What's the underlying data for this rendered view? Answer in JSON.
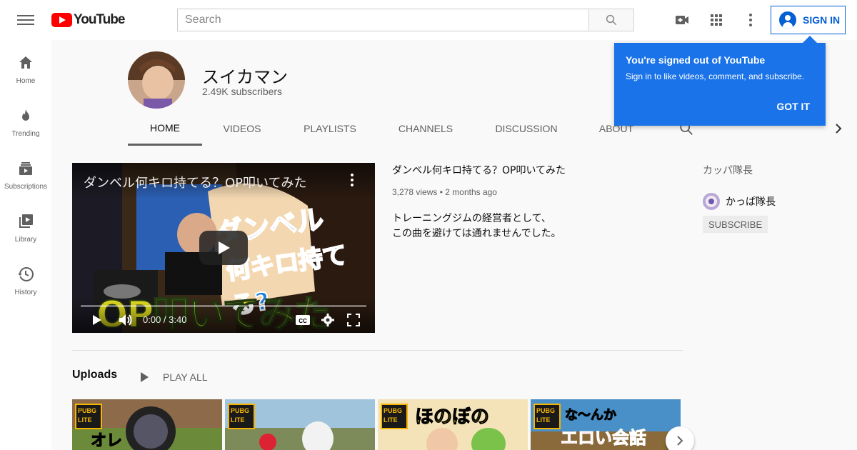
{
  "header": {
    "logo_text": "YouTube",
    "search_placeholder": "Search",
    "sign_in_label": "SIGN IN"
  },
  "sidebar": {
    "items": [
      {
        "label": "Home",
        "icon": "home-icon"
      },
      {
        "label": "Trending",
        "icon": "flame-icon"
      },
      {
        "label": "Subscriptions",
        "icon": "subscriptions-icon"
      },
      {
        "label": "Library",
        "icon": "library-icon"
      },
      {
        "label": "History",
        "icon": "history-icon"
      }
    ]
  },
  "channel": {
    "name": "スイカマン",
    "subscribers": "2.49K subscribers",
    "tabs": [
      "HOME",
      "VIDEOS",
      "PLAYLISTS",
      "CHANNELS",
      "DISCUSSION",
      "ABOUT"
    ],
    "active_tab": "HOME"
  },
  "featured_video": {
    "overlay_title": "ダンベル何キロ持てる？OP叩いてみた",
    "title": "ダンベル何キロ持てる？OP叩いてみた",
    "views": "3,278 views",
    "age": "2 months ago",
    "description_lines": [
      "トレーニングジムの経営者として、",
      "この曲を避けては通れませんでした。"
    ],
    "time": "0:00 / 3:40",
    "thumbnail_caption": "OP叩いてみた",
    "thumbnail_logo": "ダンベル",
    "thumbnail_logo_2": "何キロ持てる?"
  },
  "uploads": {
    "title": "Uploads",
    "play_all_label": "PLAY ALL",
    "thumbs": [
      {
        "badge": "PUBG LITE",
        "text": "オレ"
      },
      {
        "badge": "PUBG LITE",
        "text": ""
      },
      {
        "badge": "PUBG LITE",
        "text": "ほのぼの"
      },
      {
        "badge": "PUBG LITE",
        "text": "な〜んか",
        "text2": "エロい会話"
      }
    ]
  },
  "featured_channels": {
    "title": "カッパ隊長",
    "channel_name": "かっぱ隊長",
    "subscribe_label": "SUBSCRIBE"
  },
  "popup": {
    "title": "You're signed out of YouTube",
    "text": "Sign in to like videos, comment, and subscribe.",
    "button": "GOT IT"
  },
  "colors": {
    "brand_red": "#ff0000",
    "accent_blue": "#065fd4",
    "popup_blue": "#1a73e8"
  }
}
